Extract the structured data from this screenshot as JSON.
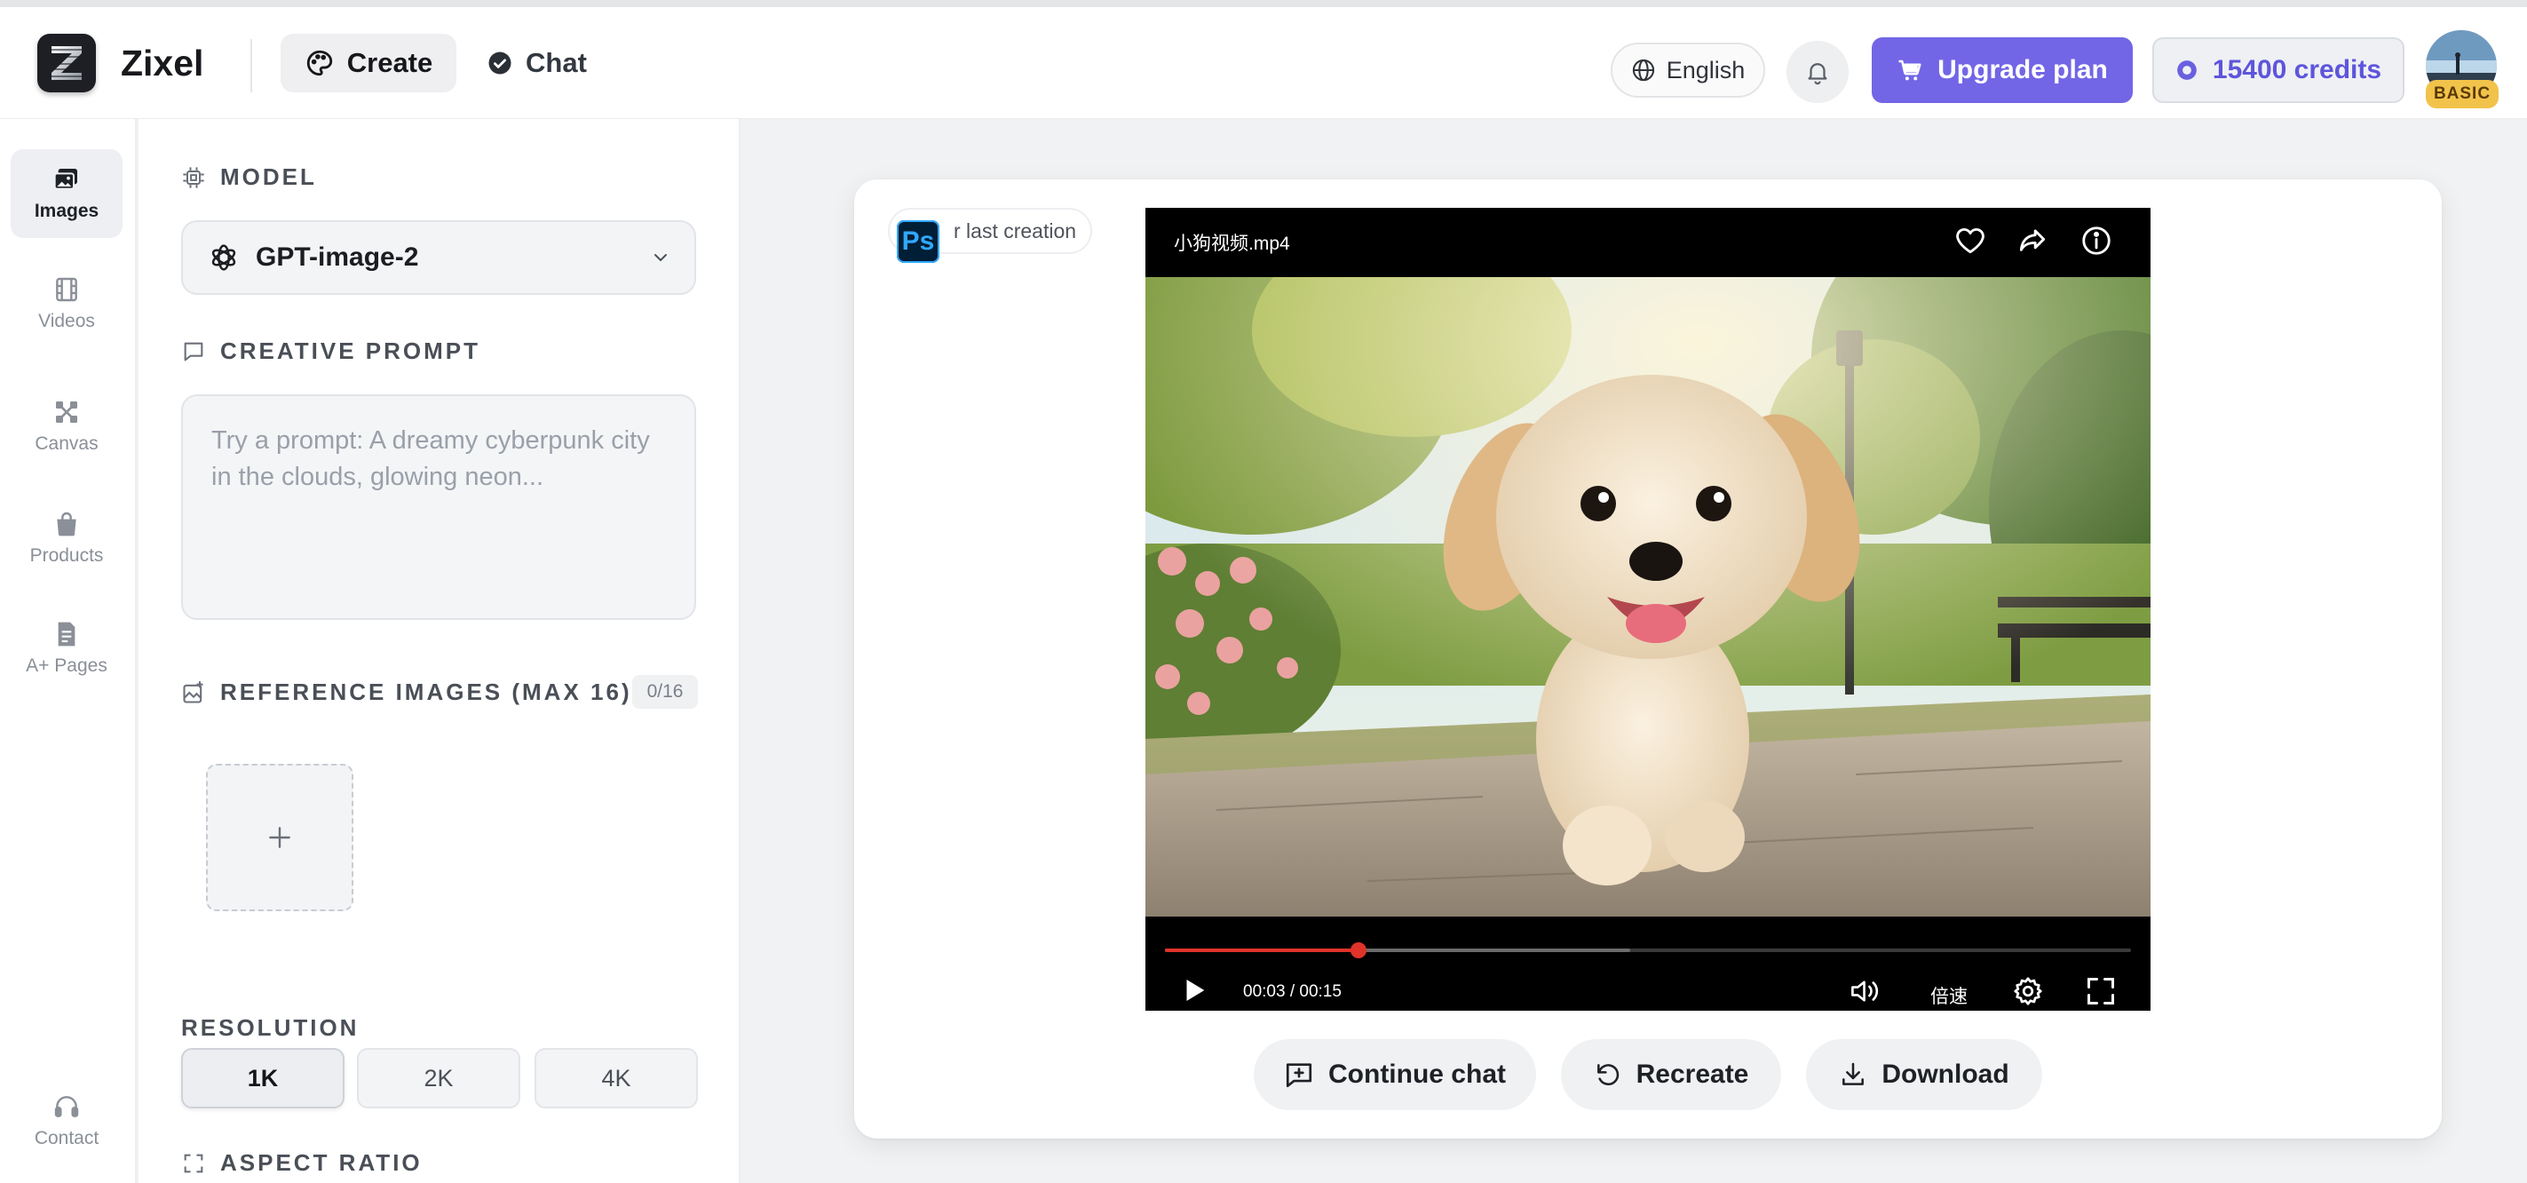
{
  "brand": {
    "name": "Zixel"
  },
  "nav": {
    "create_label": "Create",
    "chat_label": "Chat"
  },
  "header": {
    "language": "English",
    "upgrade_label": "Upgrade plan",
    "credits_label": "15400 credits",
    "plan_badge": "BASIC"
  },
  "rail": {
    "items": [
      {
        "label": "Images",
        "icon": "images-icon",
        "active": true
      },
      {
        "label": "Videos",
        "icon": "film-icon",
        "active": false
      },
      {
        "label": "Canvas",
        "icon": "canvas-icon",
        "active": false
      },
      {
        "label": "Products",
        "icon": "shopping-bag-icon",
        "active": false
      },
      {
        "label": "A+ Pages",
        "icon": "document-icon",
        "active": false
      }
    ],
    "contact_label": "Contact"
  },
  "panel": {
    "model_heading": "MODEL",
    "model_value": "GPT-image-2",
    "prompt_heading": "CREATIVE PROMPT",
    "prompt_placeholder": "Try a prompt: A dreamy cyberpunk city in the clouds, glowing neon...",
    "prompt_value": "",
    "reference_heading": "REFERENCE IMAGES (MAX 16)",
    "reference_count": "0/16",
    "resolution_heading": "RESOLUTION",
    "resolutions": [
      "1K",
      "2K",
      "4K"
    ],
    "resolution_selected": "1K",
    "aspect_heading": "ASPECT RATIO"
  },
  "result": {
    "last_creation_label": "r last creation",
    "ps_label": "Ps",
    "video": {
      "filename": "小狗视频.mp4",
      "time_label": "00:03 / 00:15",
      "speed_label": "倍速",
      "progress": 0.2,
      "buffered": 0.48
    },
    "actions": {
      "continue_label": "Continue chat",
      "recreate_label": "Recreate",
      "download_label": "Download"
    }
  },
  "colors": {
    "accent": "#7266e6",
    "credits_text": "#5e55db",
    "progress": "#e0332a",
    "badge": "#f2c34b"
  }
}
